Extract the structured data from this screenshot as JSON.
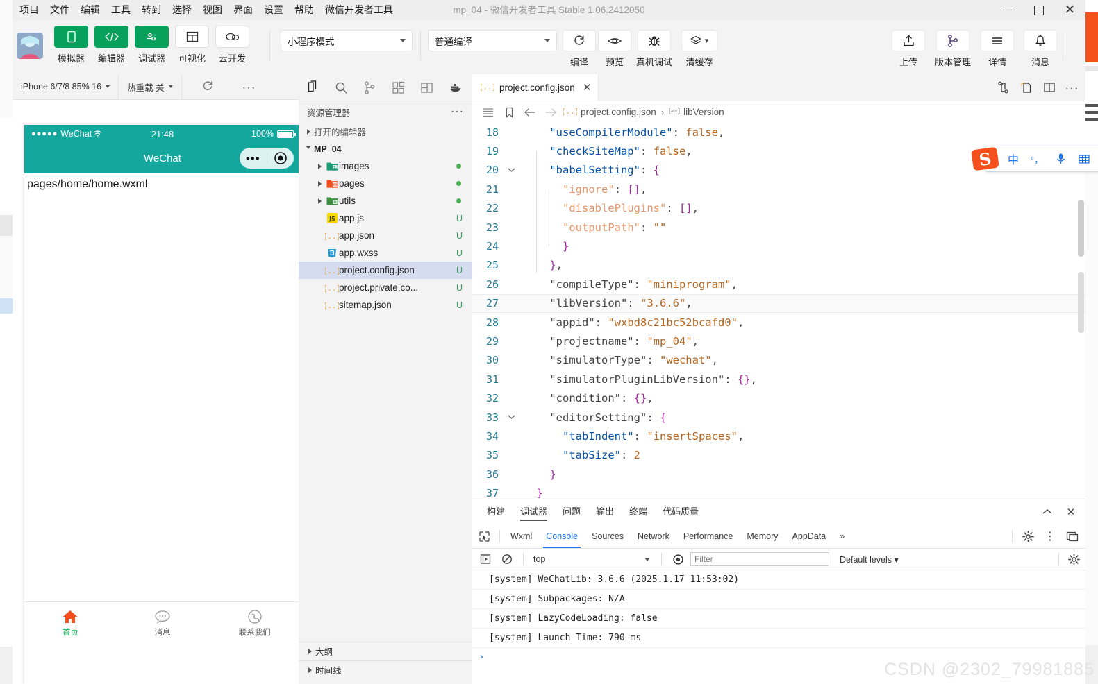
{
  "window": {
    "title": "mp_04 - 微信开发者工具 Stable 1.06.2412050",
    "menus": [
      "项目",
      "文件",
      "编辑",
      "工具",
      "转到",
      "选择",
      "视图",
      "界面",
      "设置",
      "帮助",
      "微信开发者工具"
    ],
    "controls": {
      "minimize": "minimize-icon",
      "maximize": "maximize-icon",
      "close": "✕"
    }
  },
  "toolbar": {
    "modes": [
      {
        "label": "模拟器",
        "icon": "phone-icon",
        "active": true
      },
      {
        "label": "编辑器",
        "icon": "code-icon",
        "active": true
      },
      {
        "label": "调试器",
        "icon": "sliders-icon",
        "active": true
      },
      {
        "label": "可视化",
        "icon": "layout-icon",
        "active": false
      },
      {
        "label": "云开发",
        "icon": "cloud-icon",
        "active": false
      }
    ],
    "mode_select": "小程序模式",
    "compile_select": "普通编译",
    "actions": [
      {
        "label": "编译",
        "icon": "refresh-icon"
      },
      {
        "label": "预览",
        "icon": "eye-icon"
      },
      {
        "label": "真机调试",
        "icon": "bug-icon"
      },
      {
        "label": "清缓存",
        "icon": "layers-icon"
      }
    ],
    "right_actions": [
      {
        "label": "上传",
        "icon": "upload-icon"
      },
      {
        "label": "版本管理",
        "icon": "branch-icon"
      },
      {
        "label": "详情",
        "icon": "menu-icon"
      },
      {
        "label": "消息",
        "icon": "bell-icon"
      }
    ]
  },
  "simulator": {
    "device": "iPhone 6/7/8 85% 16",
    "hotreload": "热重载 关",
    "refresh_icon": "refresh-icon",
    "more_icon": "more-icon",
    "phone": {
      "carrier": "WeChat",
      "signal_dots": "●●●●●",
      "wifi_icon": "wifi-icon",
      "time": "21:48",
      "battery_pct": "100%",
      "nav_title": "WeChat",
      "capsule_dots": "•••",
      "capsule_target": "target-icon",
      "page_path": "pages/home/home.wxml",
      "tabs": [
        {
          "label": "首页",
          "icon": "home-icon",
          "active": true
        },
        {
          "label": "消息",
          "icon": "chat-icon",
          "active": false
        },
        {
          "label": "联系我们",
          "icon": "phone-call-icon",
          "active": false
        }
      ]
    }
  },
  "explorer": {
    "activity_icons": [
      "files-icon",
      "search-icon",
      "source-control-icon",
      "extensions-icon",
      "split-icon",
      "docker-icon"
    ],
    "title": "资源管理器",
    "more_icon": "···",
    "open_editors": "打开的编辑器",
    "project": "MP_04",
    "files": [
      {
        "name": "images",
        "type": "folder",
        "icon": "folder-images-icon",
        "status": "dot",
        "indent": 1
      },
      {
        "name": "pages",
        "type": "folder",
        "icon": "folder-pages-icon",
        "status": "dot",
        "indent": 1
      },
      {
        "name": "utils",
        "type": "folder",
        "icon": "folder-utils-icon",
        "status": "dot",
        "indent": 1
      },
      {
        "name": "app.js",
        "type": "file",
        "icon": "js-icon",
        "status": "U",
        "indent": 1
      },
      {
        "name": "app.json",
        "type": "file",
        "icon": "json-icon",
        "status": "U",
        "indent": 1
      },
      {
        "name": "app.wxss",
        "type": "file",
        "icon": "css-icon",
        "status": "U",
        "indent": 1
      },
      {
        "name": "project.config.json",
        "type": "file",
        "icon": "json-icon",
        "status": "U",
        "indent": 1,
        "selected": true
      },
      {
        "name": "project.private.co...",
        "type": "file",
        "icon": "json-icon",
        "status": "U",
        "indent": 1
      },
      {
        "name": "sitemap.json",
        "type": "file",
        "icon": "json-icon",
        "status": "U",
        "indent": 1
      }
    ],
    "panels": [
      "大纲",
      "时间线"
    ]
  },
  "editor": {
    "tab": {
      "name": "project.config.json",
      "icon": "json-icon",
      "close": "✕"
    },
    "tab_actions": [
      "compare-icon",
      "new-file-icon",
      "split-editor-icon",
      "more-icon"
    ],
    "breadcrumb": {
      "icons": [
        "outline-icon",
        "bookmark-icon",
        "back-arrow-icon",
        "forward-arrow-icon"
      ],
      "parts": [
        "project.config.json",
        "libVersion"
      ],
      "separator": "›"
    },
    "lines": [
      {
        "n": "18",
        "fold": "",
        "indent": 2,
        "tokens": [
          {
            "t": "\"useCompilerModule\"",
            "c": "key"
          },
          {
            "t": ": ",
            "c": "pun"
          },
          {
            "t": "false",
            "c": "bool"
          },
          {
            "t": ",",
            "c": "pun"
          }
        ]
      },
      {
        "n": "19",
        "fold": "",
        "indent": 2,
        "tokens": [
          {
            "t": "\"checkSiteMap\"",
            "c": "key"
          },
          {
            "t": ": ",
            "c": "pun"
          },
          {
            "t": "false",
            "c": "bool"
          },
          {
            "t": ",",
            "c": "pun"
          }
        ]
      },
      {
        "n": "20",
        "fold": "v",
        "indent": 2,
        "tokens": [
          {
            "t": "\"babelSetting\"",
            "c": "key"
          },
          {
            "t": ": ",
            "c": "pun"
          },
          {
            "t": "{",
            "c": "brc"
          }
        ]
      },
      {
        "n": "21",
        "fold": "",
        "indent": 3,
        "tokens": [
          {
            "t": "\"ignore\"",
            "c": "key2"
          },
          {
            "t": ": ",
            "c": "pun"
          },
          {
            "t": "[]",
            "c": "brc"
          },
          {
            "t": ",",
            "c": "pun"
          }
        ]
      },
      {
        "n": "22",
        "fold": "",
        "indent": 3,
        "tokens": [
          {
            "t": "\"disablePlugins\"",
            "c": "key2"
          },
          {
            "t": ": ",
            "c": "pun"
          },
          {
            "t": "[]",
            "c": "brc"
          },
          {
            "t": ",",
            "c": "pun"
          }
        ]
      },
      {
        "n": "23",
        "fold": "",
        "indent": 3,
        "tokens": [
          {
            "t": "\"outputPath\"",
            "c": "key2"
          },
          {
            "t": ": ",
            "c": "pun"
          },
          {
            "t": "\"\"",
            "c": "strv"
          }
        ]
      },
      {
        "n": "24",
        "fold": "",
        "indent": 3,
        "tokens": [
          {
            "t": "}",
            "c": "brc"
          }
        ]
      },
      {
        "n": "25",
        "fold": "",
        "indent": 2,
        "tokens": [
          {
            "t": "}",
            "c": "brc"
          },
          {
            "t": ",",
            "c": "pun"
          }
        ]
      },
      {
        "n": "26",
        "fold": "",
        "indent": 2,
        "tokens": [
          {
            "t": "\"compileType\"",
            "c": "pun"
          },
          {
            "t": ": ",
            "c": "pun"
          },
          {
            "t": "\"miniprogram\"",
            "c": "strv"
          },
          {
            "t": ",",
            "c": "pun"
          }
        ]
      },
      {
        "n": "27",
        "fold": "",
        "indent": 2,
        "highlight": true,
        "tokens": [
          {
            "t": "\"libVersion\"",
            "c": "pun"
          },
          {
            "t": ": ",
            "c": "pun"
          },
          {
            "t": "\"3.6.6\"",
            "c": "strv"
          },
          {
            "t": ",",
            "c": "pun"
          }
        ]
      },
      {
        "n": "28",
        "fold": "",
        "indent": 2,
        "tokens": [
          {
            "t": "\"appid\"",
            "c": "pun"
          },
          {
            "t": ": ",
            "c": "pun"
          },
          {
            "t": "\"wxbd8c21bc52bcafd0\"",
            "c": "strv"
          },
          {
            "t": ",",
            "c": "pun"
          }
        ]
      },
      {
        "n": "29",
        "fold": "",
        "indent": 2,
        "tokens": [
          {
            "t": "\"projectname\"",
            "c": "pun"
          },
          {
            "t": ": ",
            "c": "pun"
          },
          {
            "t": "\"mp_04\"",
            "c": "strv"
          },
          {
            "t": ",",
            "c": "pun"
          }
        ]
      },
      {
        "n": "30",
        "fold": "",
        "indent": 2,
        "tokens": [
          {
            "t": "\"simulatorType\"",
            "c": "pun"
          },
          {
            "t": ": ",
            "c": "pun"
          },
          {
            "t": "\"wechat\"",
            "c": "strv"
          },
          {
            "t": ",",
            "c": "pun"
          }
        ]
      },
      {
        "n": "31",
        "fold": "",
        "indent": 2,
        "tokens": [
          {
            "t": "\"simulatorPluginLibVersion\"",
            "c": "pun"
          },
          {
            "t": ": ",
            "c": "pun"
          },
          {
            "t": "{}",
            "c": "brc"
          },
          {
            "t": ",",
            "c": "pun"
          }
        ]
      },
      {
        "n": "32",
        "fold": "",
        "indent": 2,
        "tokens": [
          {
            "t": "\"condition\"",
            "c": "pun"
          },
          {
            "t": ": ",
            "c": "pun"
          },
          {
            "t": "{}",
            "c": "brc"
          },
          {
            "t": ",",
            "c": "pun"
          }
        ]
      },
      {
        "n": "33",
        "fold": "v",
        "indent": 2,
        "tokens": [
          {
            "t": "\"editorSetting\"",
            "c": "pun"
          },
          {
            "t": ": ",
            "c": "pun"
          },
          {
            "t": "{",
            "c": "brc"
          }
        ]
      },
      {
        "n": "34",
        "fold": "",
        "indent": 3,
        "tokens": [
          {
            "t": "\"tabIndent\"",
            "c": "key"
          },
          {
            "t": ": ",
            "c": "pun"
          },
          {
            "t": "\"insertSpaces\"",
            "c": "strv"
          },
          {
            "t": ",",
            "c": "pun"
          }
        ]
      },
      {
        "n": "35",
        "fold": "",
        "indent": 3,
        "tokens": [
          {
            "t": "\"tabSize\"",
            "c": "key"
          },
          {
            "t": ": ",
            "c": "pun"
          },
          {
            "t": "2",
            "c": "num"
          }
        ]
      },
      {
        "n": "36",
        "fold": "",
        "indent": 2,
        "tokens": [
          {
            "t": "}",
            "c": "brc"
          }
        ]
      },
      {
        "n": "37",
        "fold": "",
        "indent": 1,
        "tokens": [
          {
            "t": "}",
            "c": "brc"
          }
        ]
      }
    ]
  },
  "devtools": {
    "top_tabs": [
      "构建",
      "调试器",
      "问题",
      "输出",
      "终端",
      "代码质量"
    ],
    "top_active": "调试器",
    "collapse_icon": "chevron-up-icon",
    "close_icon": "✕",
    "sub_tabs": [
      "Wxml",
      "Console",
      "Sources",
      "Network",
      "Performance",
      "Memory",
      "AppData"
    ],
    "sub_active": "Console",
    "overflow": "»",
    "sub_right_icons": [
      "settings-gear-icon",
      "kebab-menu-icon",
      "dock-icon"
    ],
    "inspect_icon": "inspect-icon",
    "controls": {
      "execute_icon": "execute-icon",
      "clear_icon": "clear-console-icon",
      "context": "top",
      "eye_icon": "eye-icon",
      "filter_placeholder": "Filter",
      "levels": "Default levels ▾",
      "gear_icon": "settings-gear-icon"
    },
    "console_logs": [
      "[system] WeChatLib: 3.6.6 (2025.1.17 11:53:02)",
      "[system] Subpackages: N/A",
      "[system] LazyCodeLoading: false",
      "[system] Launch Time: 790 ms"
    ],
    "prompt": "›"
  },
  "ime": {
    "logo": "S",
    "items": [
      "中",
      "°，",
      "mic-icon",
      "keyboard-icon"
    ]
  },
  "watermark": "CSDN @2302_79981885",
  "colors": {
    "accent_green": "#07a15b",
    "phone_teal": "#14a79d",
    "selection_blue": "#d6dcf0",
    "link_blue": "#1a73e8",
    "home_red": "#f4511e"
  }
}
